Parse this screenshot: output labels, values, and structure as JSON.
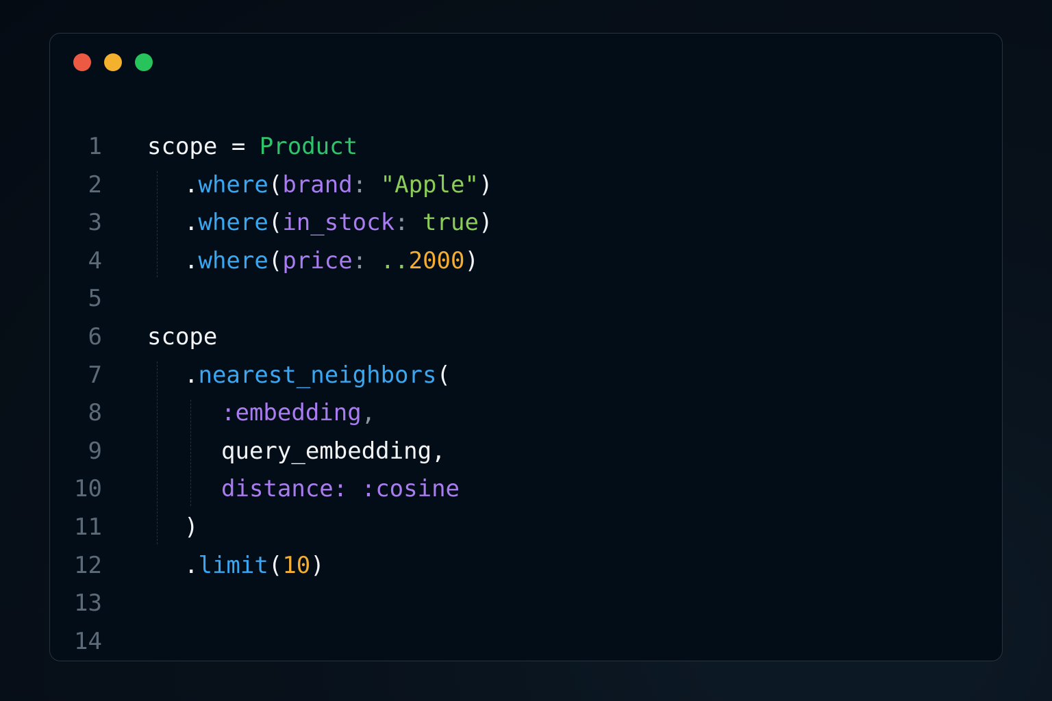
{
  "window": {
    "controls": {
      "close_color": "#ec5a43",
      "minimize_color": "#f3b12e",
      "maximize_color": "#27c35b"
    }
  },
  "code": {
    "language": "ruby",
    "lines": [
      {
        "number": "1",
        "indent": 0,
        "tokens": [
          {
            "text": "scope",
            "type": "plain"
          },
          {
            "text": " = ",
            "type": "plain"
          },
          {
            "text": "Product",
            "type": "const"
          }
        ]
      },
      {
        "number": "2",
        "indent": 1,
        "tokens": [
          {
            "text": ".",
            "type": "plain"
          },
          {
            "text": "where",
            "type": "method"
          },
          {
            "text": "(",
            "type": "plain"
          },
          {
            "text": "brand",
            "type": "sym"
          },
          {
            "text": ": ",
            "type": "punct"
          },
          {
            "text": "\"Apple\"",
            "type": "str"
          },
          {
            "text": ")",
            "type": "plain"
          }
        ]
      },
      {
        "number": "3",
        "indent": 1,
        "tokens": [
          {
            "text": ".",
            "type": "plain"
          },
          {
            "text": "where",
            "type": "method"
          },
          {
            "text": "(",
            "type": "plain"
          },
          {
            "text": "in_stock",
            "type": "sym"
          },
          {
            "text": ": ",
            "type": "punct"
          },
          {
            "text": "true",
            "type": "bool"
          },
          {
            "text": ")",
            "type": "plain"
          }
        ]
      },
      {
        "number": "4",
        "indent": 1,
        "tokens": [
          {
            "text": ".",
            "type": "plain"
          },
          {
            "text": "where",
            "type": "method"
          },
          {
            "text": "(",
            "type": "plain"
          },
          {
            "text": "price",
            "type": "sym"
          },
          {
            "text": ": ",
            "type": "punct"
          },
          {
            "text": "..",
            "type": "str"
          },
          {
            "text": "2000",
            "type": "num"
          },
          {
            "text": ")",
            "type": "plain"
          }
        ]
      },
      {
        "number": "5",
        "indent": 0,
        "tokens": []
      },
      {
        "number": "6",
        "indent": 0,
        "tokens": [
          {
            "text": "scope",
            "type": "plain"
          }
        ]
      },
      {
        "number": "7",
        "indent": 1,
        "tokens": [
          {
            "text": ".",
            "type": "plain"
          },
          {
            "text": "nearest_neighbors",
            "type": "method"
          },
          {
            "text": "(",
            "type": "plain"
          }
        ]
      },
      {
        "number": "8",
        "indent": 2,
        "tokens": [
          {
            "text": ":embedding",
            "type": "sym"
          },
          {
            "text": ",",
            "type": "punct"
          }
        ]
      },
      {
        "number": "9",
        "indent": 2,
        "tokens": [
          {
            "text": "query_embedding",
            "type": "plain"
          },
          {
            "text": ",",
            "type": "plain"
          }
        ]
      },
      {
        "number": "10",
        "indent": 2,
        "tokens": [
          {
            "text": "distance",
            "type": "sym"
          },
          {
            "text": ": ",
            "type": "sym"
          },
          {
            "text": ":cosine",
            "type": "sym"
          }
        ]
      },
      {
        "number": "11",
        "indent": 1,
        "tokens": [
          {
            "text": ")",
            "type": "plain"
          }
        ]
      },
      {
        "number": "12",
        "indent": 1,
        "tokens": [
          {
            "text": ".",
            "type": "plain"
          },
          {
            "text": "limit",
            "type": "method"
          },
          {
            "text": "(",
            "type": "plain"
          },
          {
            "text": "10",
            "type": "num"
          },
          {
            "text": ")",
            "type": "plain"
          }
        ]
      },
      {
        "number": "13",
        "indent": 0,
        "tokens": []
      },
      {
        "number": "14",
        "indent": 0,
        "tokens": []
      }
    ]
  }
}
